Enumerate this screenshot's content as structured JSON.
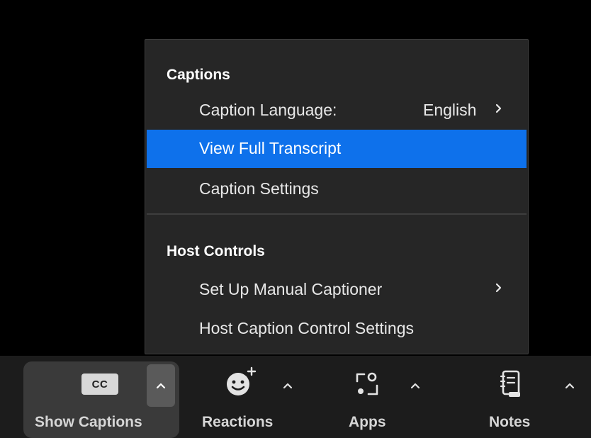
{
  "menu": {
    "captions_header": "Captions",
    "caption_language_label": "Caption Language:",
    "caption_language_value": "English",
    "view_full_transcript": "View Full Transcript",
    "caption_settings": "Caption Settings",
    "host_controls_header": "Host Controls",
    "set_up_manual_captioner": "Set Up Manual Captioner",
    "host_caption_control_settings": "Host Caption Control Settings"
  },
  "toolbar": {
    "show_captions_label": "Show Captions",
    "cc_badge": "CC",
    "reactions_label": "Reactions",
    "apps_label": "Apps",
    "notes_label": "Notes"
  },
  "colors": {
    "highlight": "#0e71eb",
    "menu_bg": "#262626",
    "toolbar_bg": "#1c1c1c",
    "active_tool_bg": "#3a3a3a"
  },
  "icons": {
    "cc": "cc-icon",
    "reactions": "smiley-plus-icon",
    "apps": "apps-icon",
    "notes": "notebook-icon",
    "caret": "caret-up-icon",
    "submenu": "chevron-right-icon"
  }
}
